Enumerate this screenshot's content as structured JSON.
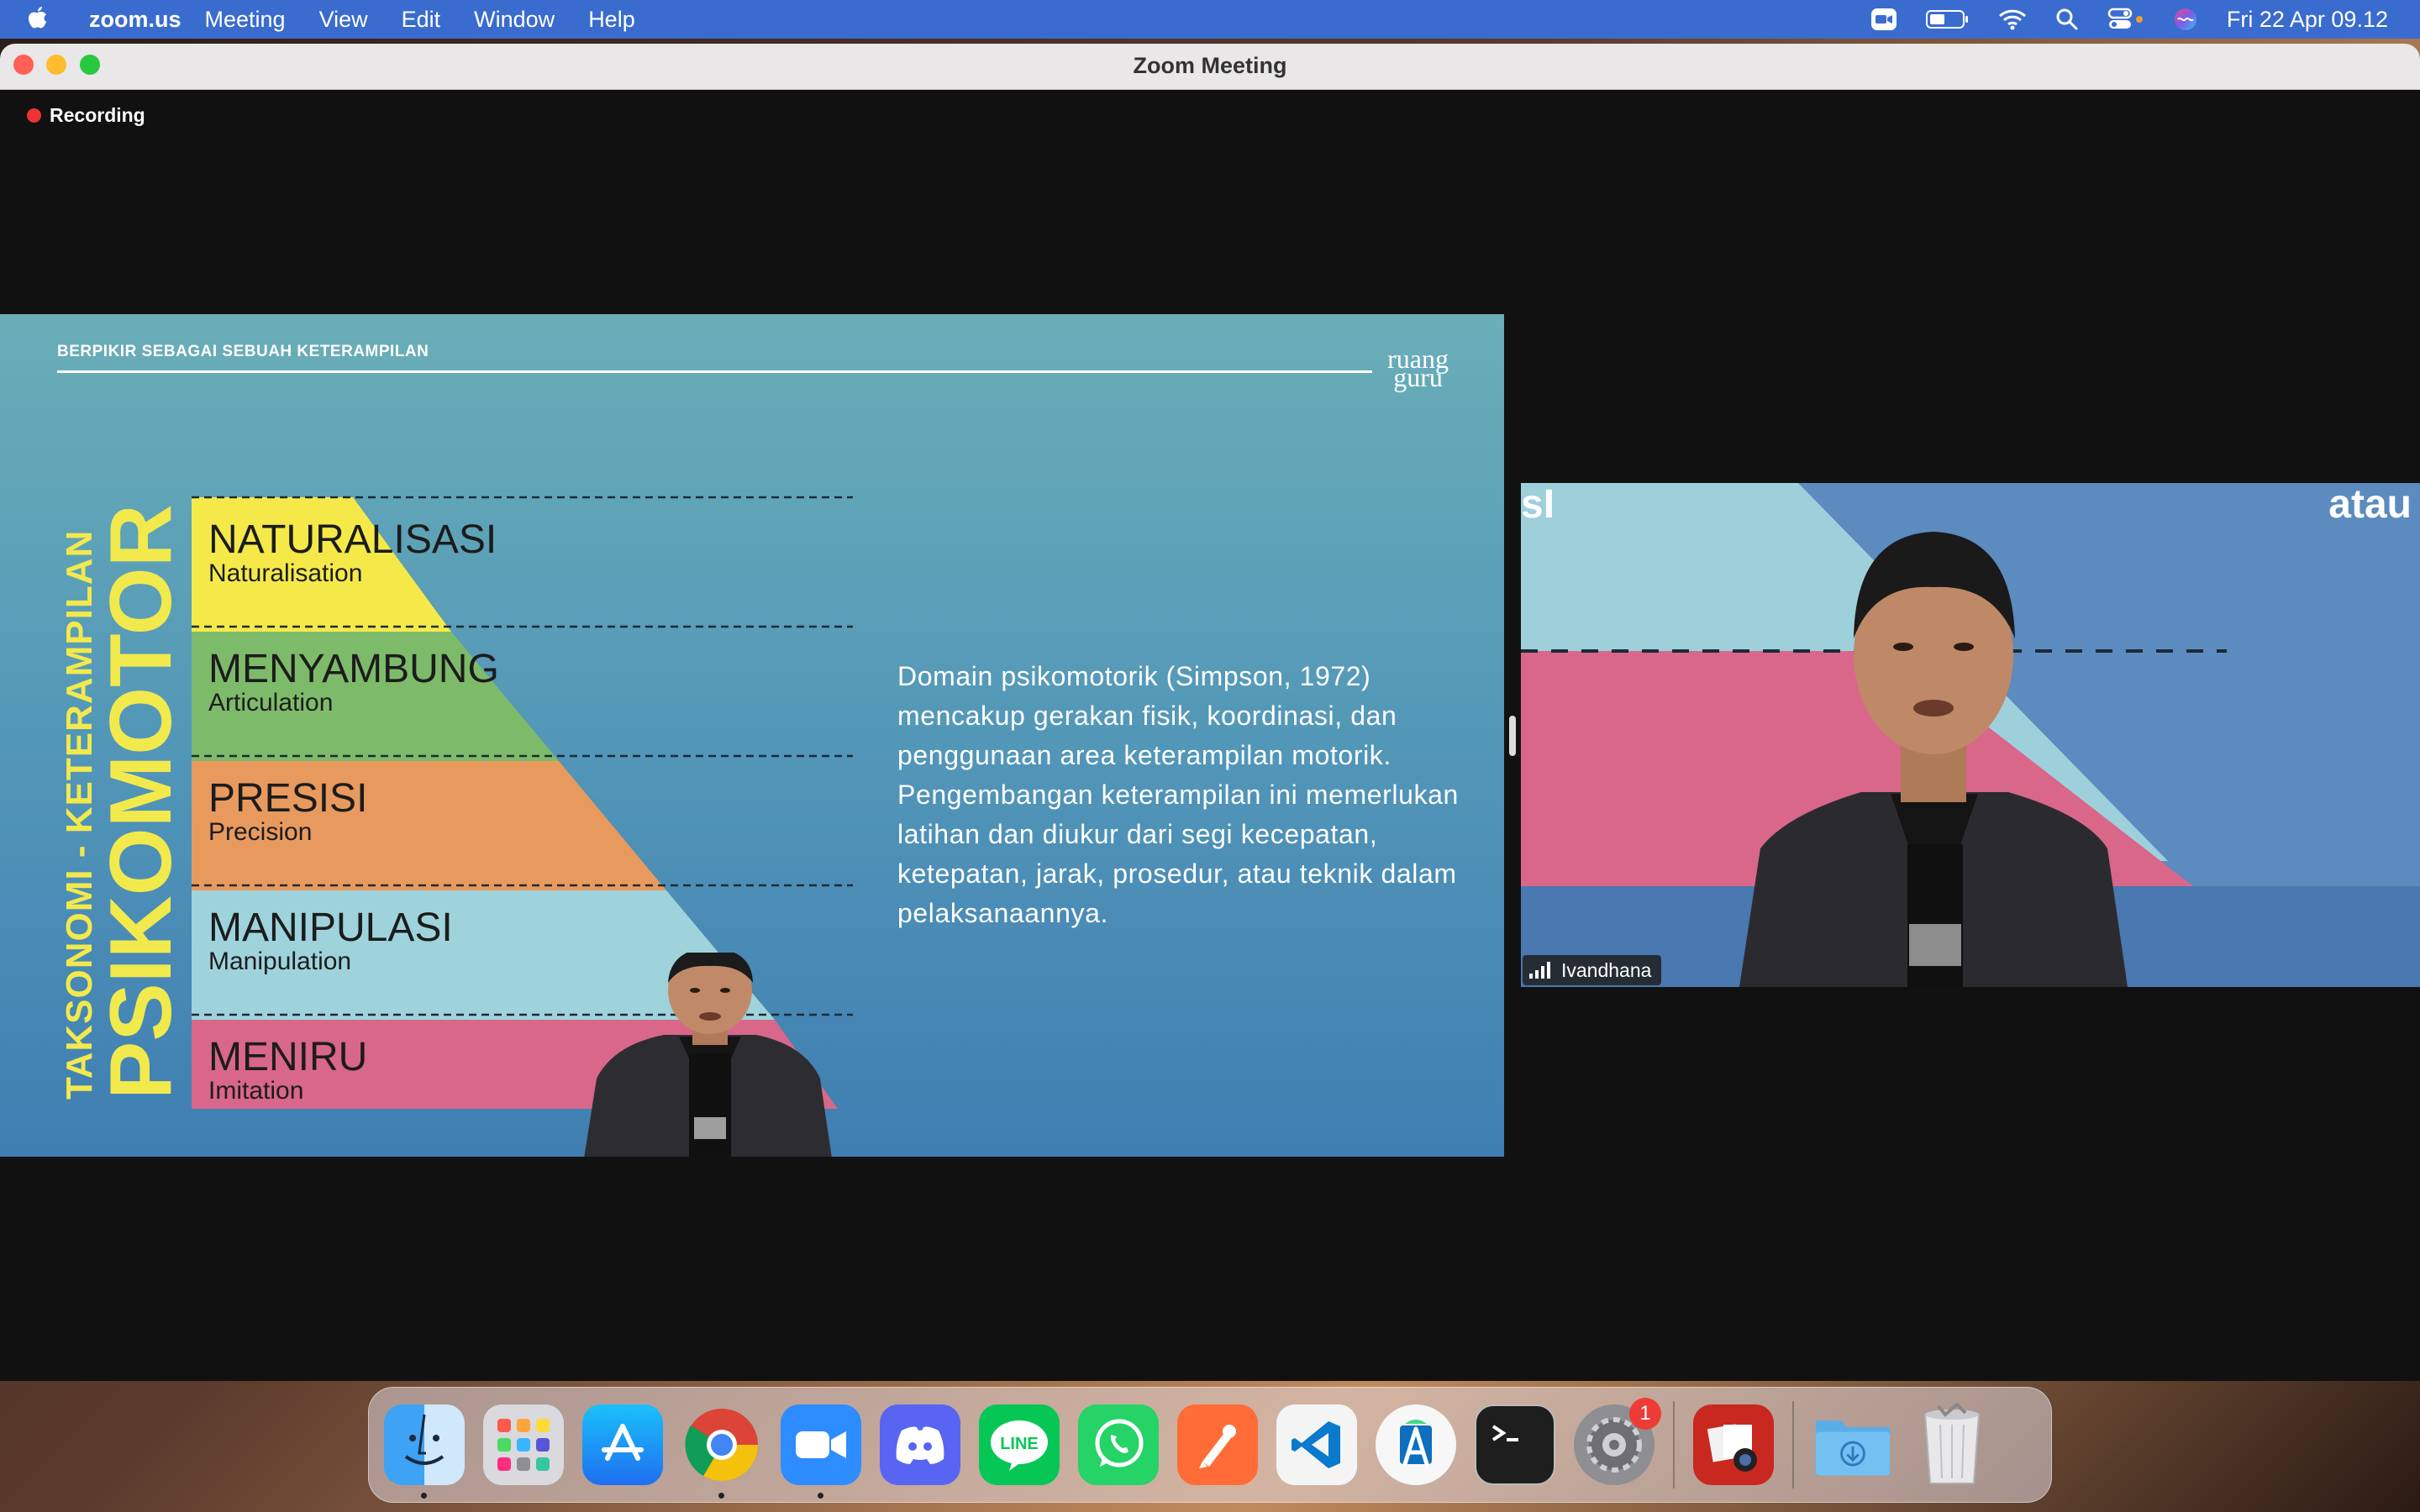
{
  "menubar": {
    "app_name": "zoom.us",
    "menus": [
      "Meeting",
      "View",
      "Edit",
      "Window",
      "Help"
    ],
    "clock": "Fri 22 Apr  09.12",
    "status_icons": [
      "zoom-camera-icon",
      "battery-icon",
      "wifi-icon",
      "search-icon",
      "control-center-icon",
      "siri-icon"
    ]
  },
  "window": {
    "title": "Zoom Meeting",
    "recording_label": "Recording"
  },
  "slide": {
    "header": "BERPIKIR SEBAGAI SEBUAH KETERAMPILAN",
    "brand_line1": "ruang",
    "brand_line2": "guru",
    "vertical_small": "TAKSONOMI - KETERAMPILAN",
    "vertical_big": "PSIKOMOTOR",
    "levels": [
      {
        "name": "NATURALISASI",
        "sub": "Naturalisation",
        "color": "#f5e94a"
      },
      {
        "name": "MENYAMBUNG",
        "sub": "Articulation",
        "color": "#7dbb6a"
      },
      {
        "name": "PRESISI",
        "sub": "Precision",
        "color": "#e89a5e"
      },
      {
        "name": "MANIPULASI",
        "sub": "Manipulation",
        "color": "#9ed3dc"
      },
      {
        "name": "MENIRU",
        "sub": "Imitation",
        "color": "#d9678a"
      }
    ],
    "paragraph": "Domain psikomotorik (Simpson, 1972) mencakup gerakan fisik, koordinasi, dan penggunaan area keterampilan motorik. Pengembangan keterampilan ini memerlukan latihan dan diukur dari segi kecepatan, ketepatan, jarak, prosedur, atau teknik dalam pelaksanaannya."
  },
  "participant": {
    "name": "Ivandhana",
    "bg_text_left": "sI",
    "bg_text_right": "atau"
  },
  "dock": {
    "apps": [
      {
        "name": "Finder",
        "icon": "finder-icon",
        "running": true
      },
      {
        "name": "Launchpad",
        "icon": "launchpad-icon",
        "running": false
      },
      {
        "name": "App Store",
        "icon": "app-store-icon",
        "running": false
      },
      {
        "name": "Google Chrome",
        "icon": "chrome-icon",
        "running": true
      },
      {
        "name": "Zoom",
        "icon": "zoom-icon",
        "running": true
      },
      {
        "name": "Discord",
        "icon": "discord-icon",
        "running": false
      },
      {
        "name": "LINE",
        "icon": "line-icon",
        "label": "LINE",
        "running": false
      },
      {
        "name": "WhatsApp",
        "icon": "whatsapp-icon",
        "running": false
      },
      {
        "name": "Postman",
        "icon": "postman-icon",
        "running": false
      },
      {
        "name": "Visual Studio Code",
        "icon": "vscode-icon",
        "running": false
      },
      {
        "name": "Android Studio",
        "icon": "android-studio-icon",
        "running": false
      },
      {
        "name": "Terminal",
        "icon": "terminal-icon",
        "running": false
      },
      {
        "name": "System Preferences",
        "icon": "system-preferences-icon",
        "badge": "1",
        "running": false
      },
      {
        "name": "Photo Booth",
        "icon": "photo-booth-icon",
        "running": false
      },
      {
        "name": "Downloads",
        "icon": "downloads-folder-icon",
        "running": false
      },
      {
        "name": "Trash",
        "icon": "trash-icon",
        "running": false
      }
    ]
  }
}
